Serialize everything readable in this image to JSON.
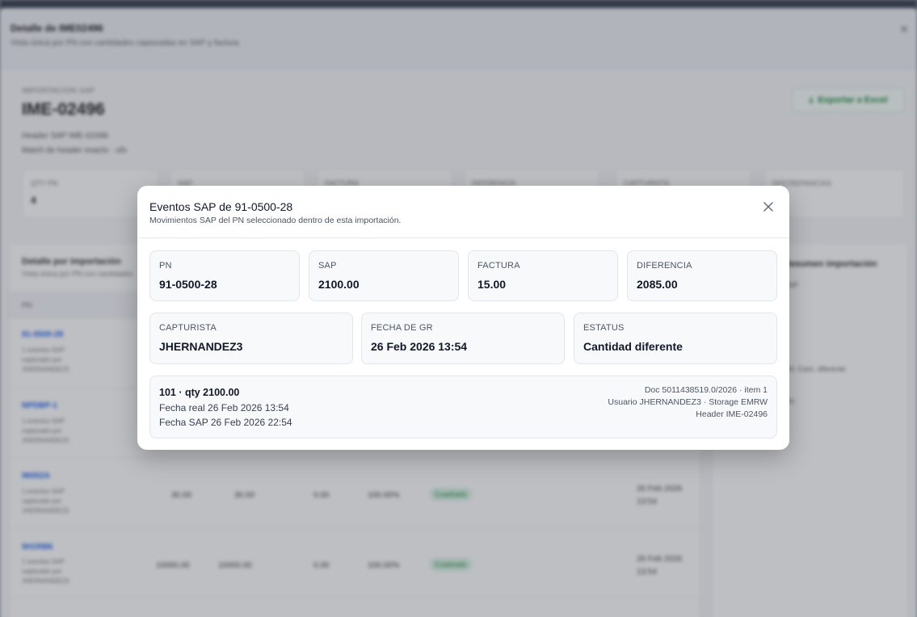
{
  "background": {
    "outer_title": "Detalle de IME02496",
    "outer_subtitle": "Vista única por PN con cantidades capturadas en SAP y factura",
    "import_label": "IMPORTACION SAP",
    "import_title": "IME-02496",
    "header_line1": "Header SAP IME-02496",
    "header_line2": "Match de header exacto · ufo",
    "export_label": "Exportar a Excel",
    "kpis": [
      {
        "label": "QTY PN",
        "value": "4"
      },
      {
        "label": "SAP",
        "value": ""
      },
      {
        "label": "FACTURA",
        "value": ""
      },
      {
        "label": "DIFERENCIA",
        "value": ""
      },
      {
        "label": "CAPTURISTA",
        "value": ""
      },
      {
        "label": "DISCREPANCIAS",
        "value": ""
      }
    ],
    "table_title": "Detalle por importación",
    "table_subtitle": "Vista única por PN con cantidades",
    "table_col_pn": "PN",
    "rows": [
      {
        "pn": "91-0500-28",
        "meta": "1 eventos SAP capturado por JHERNANDEZ3",
        "c1": "",
        "c2": "",
        "c3": "",
        "c4": "",
        "status": "",
        "date": ""
      },
      {
        "pn": "NPDBP-1",
        "meta": "1 eventos SAP capturado por JHERNANDEZ3",
        "c1": "",
        "c2": "",
        "c3": "",
        "c4": "",
        "status": "",
        "date": ""
      },
      {
        "pn": "96052A",
        "meta": "1 eventos SAP capturado por JHERNANDEZ3",
        "c1": "30.00",
        "c2": "30.00",
        "c3": "0.00",
        "c4": "100.00%",
        "status": "Cuadrado",
        "date": "26 Feb 2026 13:54"
      },
      {
        "pn": "5H1RB6",
        "meta": "1 eventos SAP capturado por JHERNANDEZ3",
        "c1": "10000.00",
        "c2": "10000.00",
        "c3": "0.00",
        "c4": "100.00%",
        "status": "Cuadrado",
        "date": "26 Feb 2026 13:54"
      }
    ],
    "side_title": "Resumen importación",
    "side_lines": [
      "SAP",
      "",
      "",
      "",
      "PN: Cant. diferente",
      "",
      "PN",
      ""
    ]
  },
  "modal": {
    "title": "Eventos SAP de 91-0500-28",
    "subtitle": "Movimientos SAP del PN seleccionado dentro de esta importación.",
    "stats_row1": [
      {
        "label": "PN",
        "value": "91-0500-28"
      },
      {
        "label": "SAP",
        "value": "2100.00"
      },
      {
        "label": "FACTURA",
        "value": "15.00"
      },
      {
        "label": "DIFERENCIA",
        "value": "2085.00"
      }
    ],
    "stats_row2": [
      {
        "label": "CAPTURISTA",
        "value": "JHERNANDEZ3"
      },
      {
        "label": "FECHA DE GR",
        "value": "26 Feb 2026 13:54"
      },
      {
        "label": "ESTATUS",
        "value": "Cantidad diferente"
      }
    ],
    "event": {
      "movement": "101 · qty 2100.00",
      "fecha_real": "Fecha real 26 Feb 2026 13:54",
      "fecha_sap": "Fecha SAP 26 Feb 2026 22:54",
      "doc": "Doc 5011438519.0/2026 · item 1",
      "usuario": "Usuario JHERNANDEZ3 · Storage EMRW",
      "header": "Header IME-02496"
    }
  },
  "colors": {
    "accent_link": "#2563eb",
    "success": "#1e8a43",
    "overlay": "rgba(35,42,55,0.30)"
  }
}
